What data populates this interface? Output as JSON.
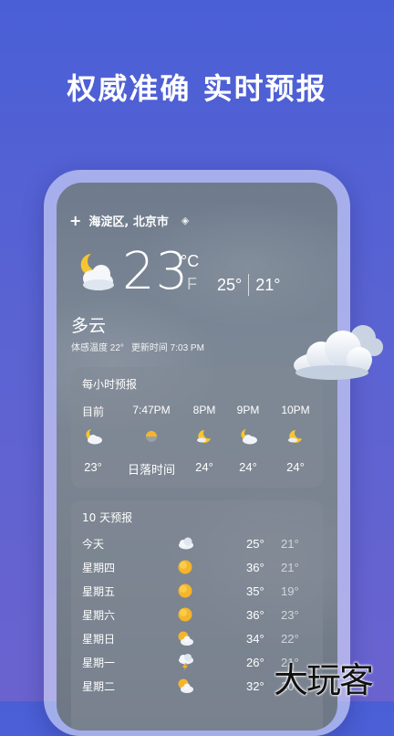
{
  "headline": "权威准确  实时预报",
  "location": {
    "name": "海淀区, 北京市"
  },
  "current": {
    "temp": "23",
    "unit_c": "°C",
    "unit_f": "F",
    "high": "25°",
    "low": "21°",
    "condition": "多云",
    "feels_like": "体感温度 22°",
    "updated": "更新时间 7:03 PM",
    "icon": "partly-cloudy-night-icon"
  },
  "hourly": {
    "title": "每小时预报",
    "items": [
      {
        "time": "目前",
        "icon": "cloud-moon-icon",
        "temp": "23°"
      },
      {
        "time": "7:47PM",
        "icon": "sunset-icon",
        "temp": "日落时间"
      },
      {
        "time": "8PM",
        "icon": "moon-icon",
        "temp": "24°"
      },
      {
        "time": "9PM",
        "icon": "cloud-moon-icon",
        "temp": "24°"
      },
      {
        "time": "10PM",
        "icon": "moon-icon",
        "temp": "24°"
      }
    ]
  },
  "daily": {
    "title": "10 天预报",
    "items": [
      {
        "day": "今天",
        "icon": "cloudy-icon",
        "high": "25°",
        "low": "21°"
      },
      {
        "day": "星期四",
        "icon": "sun-icon",
        "high": "36°",
        "low": "21°"
      },
      {
        "day": "星期五",
        "icon": "sun-icon",
        "high": "35°",
        "low": "19°"
      },
      {
        "day": "星期六",
        "icon": "sun-icon",
        "high": "36°",
        "low": "23°"
      },
      {
        "day": "星期日",
        "icon": "partly-cloudy-icon",
        "high": "34°",
        "low": "22°"
      },
      {
        "day": "星期一",
        "icon": "thunderstorm-icon",
        "high": "26°",
        "low": "21°"
      },
      {
        "day": "星期二",
        "icon": "partly-cloudy-icon",
        "high": "32°",
        "low": "20°"
      }
    ]
  },
  "watermark": "大玩客",
  "colors": {
    "background_top": "#4a5fd6",
    "background_bottom": "#6a63cf",
    "sun": "#f5b52a"
  }
}
